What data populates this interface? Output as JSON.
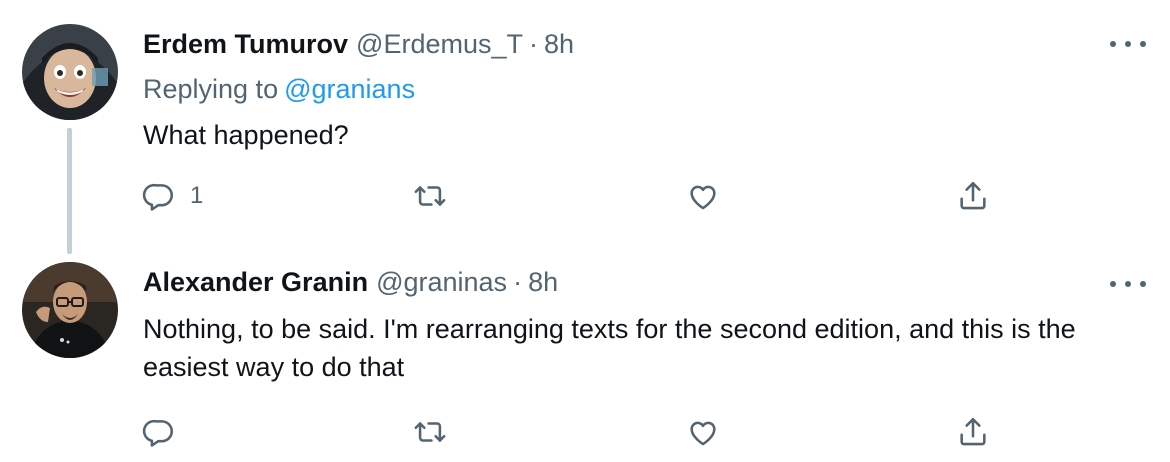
{
  "tweets": [
    {
      "name": "Erdem Tumurov",
      "handle": "@Erdemus_T",
      "separator": "·",
      "time": "8h",
      "replying_prefix": "Replying to",
      "replying_mention": "@granians",
      "text": "What happened?",
      "reply_count": "1",
      "avatar": "avatar-photo-man-grinning-dark-hood"
    },
    {
      "name": "Alexander Granin",
      "handle": "@graninas",
      "separator": "·",
      "time": "8h",
      "text": "Nothing, to be said. I'm rearranging texts for the second edition, and this is the easiest way to do that",
      "reply_count": "",
      "avatar": "avatar-photo-man-glasses-dark-shirt"
    }
  ],
  "colors": {
    "text": "#0f1419",
    "secondary": "#536471",
    "link": "#1d9bf0",
    "thread_line": "#c4cfd6"
  },
  "icons": [
    "reply-icon",
    "retweet-icon",
    "like-icon",
    "share-icon",
    "more-icon"
  ]
}
